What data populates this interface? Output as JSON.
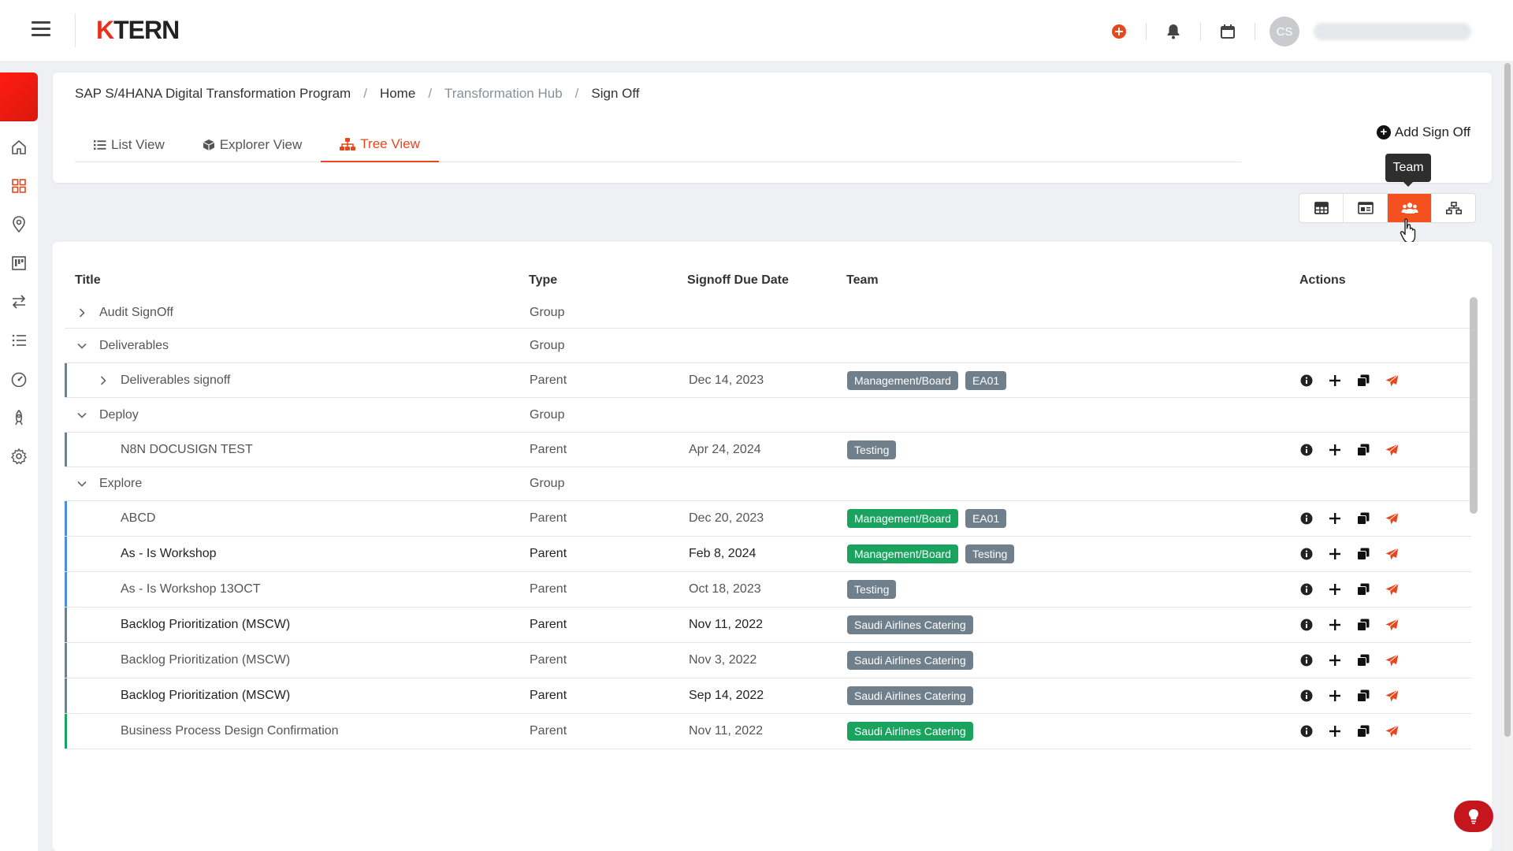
{
  "topbar": {
    "logo_prefix": "K",
    "logo_rest": "TERN",
    "avatar_initials": "CS"
  },
  "breadcrumb": {
    "program": "SAP S/4HANA Digital Transformation Program",
    "home": "Home",
    "hub": "Transformation Hub",
    "current": "Sign Off",
    "separator": "/"
  },
  "tabs": [
    {
      "label": "List View",
      "icon": "list-icon"
    },
    {
      "label": "Explorer View",
      "icon": "cube-icon"
    },
    {
      "label": "Tree View",
      "icon": "sitemap-icon",
      "active": true
    }
  ],
  "add_signoff_label": "Add Sign Off",
  "tooltip": "Team",
  "view_switch": [
    {
      "icon": "table-icon"
    },
    {
      "icon": "card-icon"
    },
    {
      "icon": "team-icon",
      "active": true
    },
    {
      "icon": "hierarchy-icon"
    }
  ],
  "table": {
    "columns": {
      "title": "Title",
      "type": "Type",
      "due": "Signoff Due Date",
      "team": "Team",
      "actions": "Actions"
    },
    "rows": [
      {
        "title": "Audit SignOff",
        "type": "Group",
        "due": "",
        "level": 0,
        "expander": "collapsed",
        "teams": []
      },
      {
        "title": "Deliverables",
        "type": "Group",
        "due": "",
        "level": 0,
        "expander": "expanded",
        "teams": []
      },
      {
        "title": "Deliverables signoff",
        "type": "Parent",
        "due": "Dec 14, 2023",
        "level": 1,
        "expander": "collapsed",
        "teams": [
          {
            "name": "Management/Board",
            "color": "grey"
          },
          {
            "name": "EA01",
            "color": "grey"
          }
        ]
      },
      {
        "title": "Deploy",
        "type": "Group",
        "due": "",
        "level": 0,
        "expander": "expanded",
        "teams": []
      },
      {
        "title": "N8N DOCUSIGN TEST",
        "type": "Parent",
        "due": "Apr 24, 2024",
        "level": 1,
        "teams": [
          {
            "name": "Testing",
            "color": "grey"
          }
        ]
      },
      {
        "title": "Explore",
        "type": "Group",
        "due": "",
        "level": 0,
        "expander": "expanded",
        "teams": []
      },
      {
        "title": "ABCD",
        "type": "Parent",
        "due": "Dec 20, 2023",
        "level": 1,
        "teams": [
          {
            "name": "Management/Board",
            "color": "green"
          },
          {
            "name": "EA01",
            "color": "grey"
          }
        ]
      },
      {
        "title": "As - Is Workshop",
        "type": "Parent",
        "due": "Feb 8, 2024",
        "level": 1,
        "bold": true,
        "teams": [
          {
            "name": "Management/Board",
            "color": "green"
          },
          {
            "name": "Testing",
            "color": "grey"
          }
        ]
      },
      {
        "title": "As - Is Workshop 13OCT",
        "type": "Parent",
        "due": "Oct 18, 2023",
        "level": 1,
        "teams": [
          {
            "name": "Testing",
            "color": "grey"
          }
        ]
      },
      {
        "title": "Backlog Prioritization (MSCW)",
        "type": "Parent",
        "due": "Nov 11, 2022",
        "level": 1,
        "bold": true,
        "teams": [
          {
            "name": "Saudi Airlines Catering",
            "color": "grey"
          }
        ]
      },
      {
        "title": "Backlog Prioritization (MSCW)",
        "type": "Parent",
        "due": "Nov 3, 2022",
        "level": 1,
        "teams": [
          {
            "name": "Saudi Airlines Catering",
            "color": "grey"
          }
        ]
      },
      {
        "title": "Backlog Prioritization (MSCW)",
        "type": "Parent",
        "due": "Sep 14, 2022",
        "level": 1,
        "bold": true,
        "teams": [
          {
            "name": "Saudi Airlines Catering",
            "color": "grey"
          }
        ]
      },
      {
        "title": "Business Process Design Confirmation",
        "type": "Parent",
        "due": "Nov 11, 2022",
        "level": 1,
        "teams": [
          {
            "name": "Saudi Airlines Catering",
            "color": "green"
          }
        ]
      }
    ]
  },
  "colors": {
    "accent": "#e8461c",
    "active_view": "#f4511e",
    "badge_grey": "#6f7f8c",
    "badge_green": "#1aa35e",
    "send_icon": "#e8461c"
  }
}
